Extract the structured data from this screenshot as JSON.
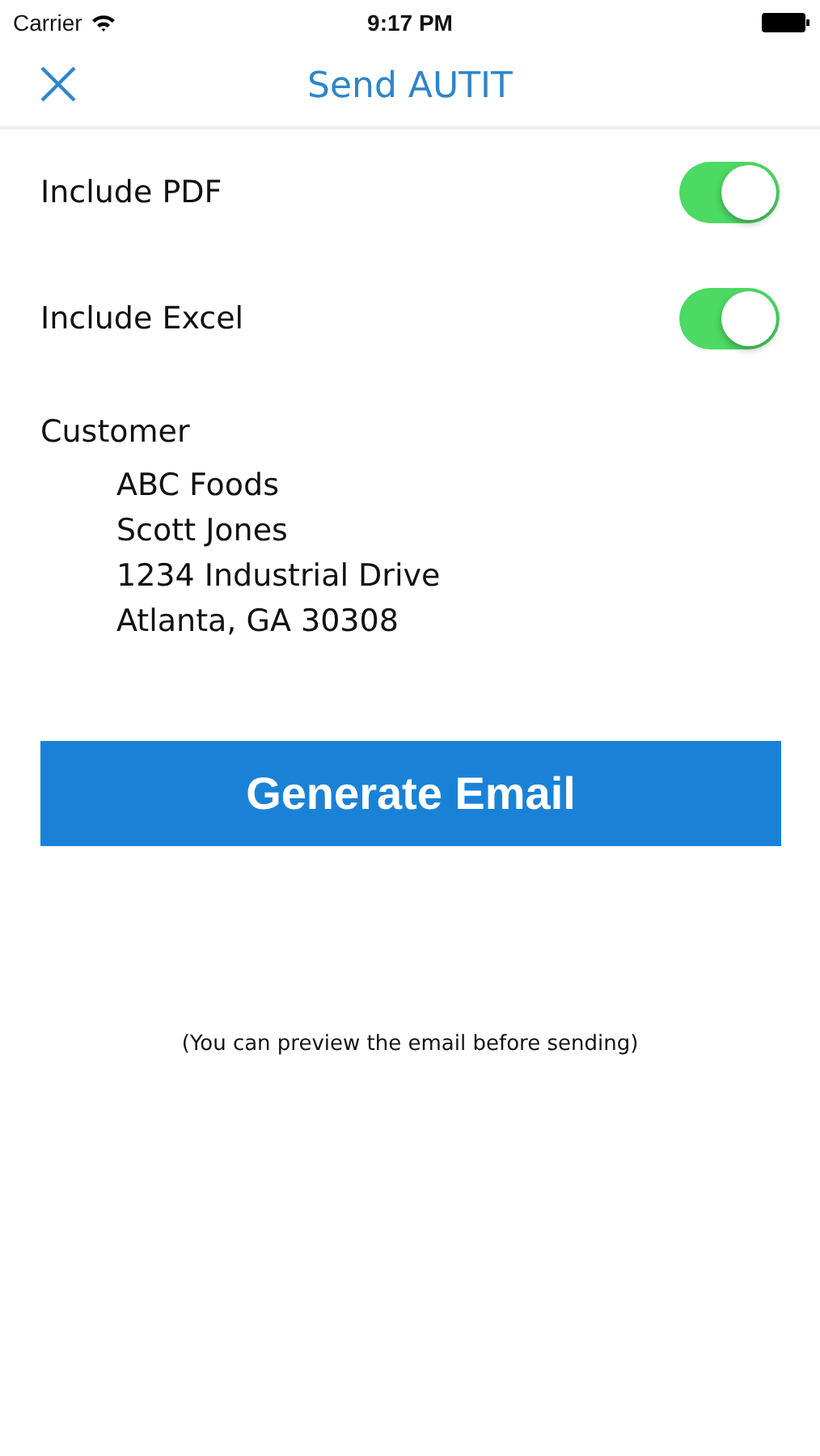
{
  "status_bar": {
    "carrier": "Carrier",
    "time": "9:17 PM"
  },
  "nav": {
    "title": "Send AUTIT"
  },
  "toggles": [
    {
      "label": "Include PDF",
      "on": true
    },
    {
      "label": "Include Excel",
      "on": true
    }
  ],
  "customer": {
    "heading": "Customer",
    "lines": [
      "ABC Foods",
      "Scott Jones",
      "1234 Industrial Drive",
      "Atlanta, GA 30308"
    ]
  },
  "button": "Generate Email",
  "note": "(You can preview the email before sending)"
}
